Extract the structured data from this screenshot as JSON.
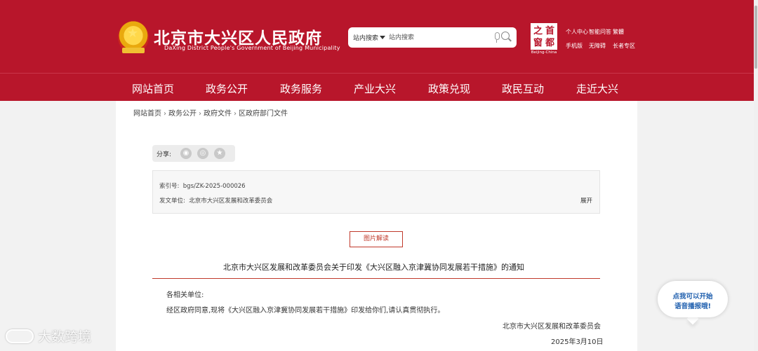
{
  "header": {
    "title": "北京市大兴区人民政府",
    "subtitle": "DaXing District People's Government of Beijing Municipality",
    "search": {
      "scope": "站内搜索",
      "placeholder": "站内搜索"
    },
    "capital_logo": {
      "chars": [
        "之",
        "首",
        "窗",
        "都"
      ],
      "caption": "Beijing-China"
    },
    "utility_links": [
      "个人中心",
      "智能问答",
      "繁體",
      "手机版",
      "无障碍",
      "长者专区"
    ]
  },
  "nav": {
    "items": [
      "网站首页",
      "政务公开",
      "政务服务",
      "产业大兴",
      "政策兑现",
      "政民互动",
      "走近大兴"
    ]
  },
  "breadcrumb": {
    "items": [
      "网站首页",
      "政务公开",
      "政府文件",
      "区政府部门文件"
    ]
  },
  "share": {
    "label": "分享:"
  },
  "meta": {
    "index_label": "索引号:",
    "index_value": "bgs/ZK-2025-000026",
    "issuer_label": "发文单位:",
    "issuer_value": "北京市大兴区发展和改革委员会",
    "expand_label": "展开"
  },
  "image_button": "图片解读",
  "document": {
    "title": "北京市大兴区发展和改革委员会关于印发《大兴区融入京津冀协同发展若干措施》的通知",
    "salutation": "各相关单位:",
    "body": "经区政府同意,现将《大兴区融入京津冀协同发展若干措施》印发给你们,请认真贯彻执行。",
    "signature": "北京市大兴区发展和改革委员会",
    "date": "2025年3月10日"
  },
  "voice_widget": {
    "line1": "点我可以开始",
    "line2": "语音播报哦!"
  },
  "watermark": "大数跨境",
  "colors": {
    "brand_red": "#b8162b",
    "accent_red": "#c0392b",
    "voice_blue": "#1f5fae"
  }
}
